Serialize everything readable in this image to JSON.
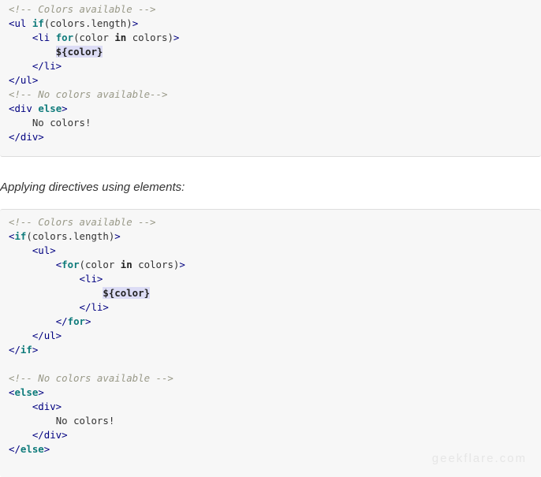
{
  "block1": {
    "lines": [
      [
        {
          "t": "<!-- Colors available -->",
          "c": "cm"
        }
      ],
      [
        {
          "t": "<ul",
          "c": "tg"
        },
        {
          "t": " "
        },
        {
          "t": "if",
          "c": "kw"
        },
        {
          "t": "(colors.length)",
          "c": "tx"
        },
        {
          "t": ">",
          "c": "tg"
        }
      ],
      [
        {
          "t": "    "
        },
        {
          "t": "<li",
          "c": "tg"
        },
        {
          "t": " "
        },
        {
          "t": "for",
          "c": "kw"
        },
        {
          "t": "(color ",
          "c": "tx"
        },
        {
          "t": "in",
          "c": "b"
        },
        {
          "t": " colors)",
          "c": "tx"
        },
        {
          "t": ">",
          "c": "tg"
        }
      ],
      [
        {
          "t": "        "
        },
        {
          "t": "${color}",
          "c": "hl"
        }
      ],
      [
        {
          "t": "    "
        },
        {
          "t": "</li>",
          "c": "tg"
        }
      ],
      [
        {
          "t": "</ul>",
          "c": "tg"
        }
      ],
      [
        {
          "t": "<!-- No colors available-->",
          "c": "cm"
        }
      ],
      [
        {
          "t": "<div",
          "c": "tg"
        },
        {
          "t": " "
        },
        {
          "t": "else",
          "c": "kw"
        },
        {
          "t": ">",
          "c": "tg"
        }
      ],
      [
        {
          "t": "    "
        },
        {
          "t": "No colors!",
          "c": "tx"
        }
      ],
      [
        {
          "t": "</div>",
          "c": "tg"
        }
      ]
    ]
  },
  "caption": "Applying directives using elements:",
  "block2": {
    "lines": [
      [
        {
          "t": "<!-- Colors available -->",
          "c": "cm"
        }
      ],
      [
        {
          "t": "<",
          "c": "tg"
        },
        {
          "t": "if",
          "c": "kw"
        },
        {
          "t": "(colors.length)",
          "c": "tx"
        },
        {
          "t": ">",
          "c": "tg"
        }
      ],
      [
        {
          "t": "    "
        },
        {
          "t": "<ul>",
          "c": "tg"
        }
      ],
      [
        {
          "t": "        "
        },
        {
          "t": "<",
          "c": "tg"
        },
        {
          "t": "for",
          "c": "kw"
        },
        {
          "t": "(color ",
          "c": "tx"
        },
        {
          "t": "in",
          "c": "b"
        },
        {
          "t": " colors)",
          "c": "tx"
        },
        {
          "t": ">",
          "c": "tg"
        }
      ],
      [
        {
          "t": "            "
        },
        {
          "t": "<li>",
          "c": "tg"
        }
      ],
      [
        {
          "t": "                "
        },
        {
          "t": "${color}",
          "c": "hl"
        }
      ],
      [
        {
          "t": "            "
        },
        {
          "t": "</li>",
          "c": "tg"
        }
      ],
      [
        {
          "t": "        "
        },
        {
          "t": "</",
          "c": "tg"
        },
        {
          "t": "for",
          "c": "kw"
        },
        {
          "t": ">",
          "c": "tg"
        }
      ],
      [
        {
          "t": "    "
        },
        {
          "t": "</ul>",
          "c": "tg"
        }
      ],
      [
        {
          "t": "</",
          "c": "tg"
        },
        {
          "t": "if",
          "c": "kw"
        },
        {
          "t": ">",
          "c": "tg"
        }
      ],
      [
        {
          "t": ""
        }
      ],
      [
        {
          "t": "<!-- No colors available -->",
          "c": "cm"
        }
      ],
      [
        {
          "t": "<",
          "c": "tg"
        },
        {
          "t": "else",
          "c": "kw"
        },
        {
          "t": ">",
          "c": "tg"
        }
      ],
      [
        {
          "t": "    "
        },
        {
          "t": "<div>",
          "c": "tg"
        }
      ],
      [
        {
          "t": "        "
        },
        {
          "t": "No colors!",
          "c": "tx"
        }
      ],
      [
        {
          "t": "    "
        },
        {
          "t": "</div>",
          "c": "tg"
        }
      ],
      [
        {
          "t": "</",
          "c": "tg"
        },
        {
          "t": "else",
          "c": "kw"
        },
        {
          "t": ">",
          "c": "tg"
        }
      ]
    ]
  },
  "watermark": "geekflare.com"
}
